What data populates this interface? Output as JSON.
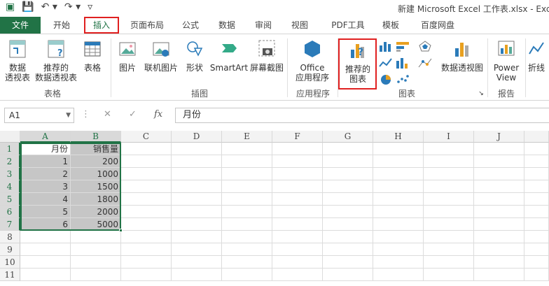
{
  "window_title": "新建 Microsoft Excel 工作表.xlsx - Exc",
  "tabs": [
    "文件",
    "开始",
    "插入",
    "页面布局",
    "公式",
    "数据",
    "审阅",
    "视图",
    "PDF工具",
    "模板",
    "百度网盘"
  ],
  "ribbon": {
    "pivot": "数据",
    "pivot2": "透视表",
    "rec_pivot": "推荐的",
    "rec_pivot2": "数据透视表",
    "table": "表格",
    "group_tables": "表格",
    "picture": "图片",
    "online_picture": "联机图片",
    "shapes": "形状",
    "smartart": "SmartArt",
    "screenshot": "屏幕截图",
    "group_illustrations": "插图",
    "office": "Office",
    "office2": "应用程序",
    "group_apps": "应用程序",
    "rec_chart": "推荐的",
    "rec_chart2": "图表",
    "group_charts": "图表",
    "pivot_chart": "数据透视图",
    "power": "Power",
    "power2": "View",
    "group_reports": "报告",
    "sparkline": "折线"
  },
  "formula_bar": {
    "name_box": "A1",
    "fx": "fx",
    "value": "月份"
  },
  "columns": [
    "A",
    "B",
    "C",
    "D",
    "E",
    "F",
    "G",
    "H",
    "I",
    "J"
  ],
  "rows": [
    "1",
    "2",
    "3",
    "4",
    "5",
    "6",
    "7",
    "8",
    "9",
    "10",
    "11"
  ],
  "sheet": {
    "headers": [
      "月份",
      "销售量"
    ],
    "data": [
      [
        "1",
        "200"
      ],
      [
        "2",
        "1000"
      ],
      [
        "3",
        "1500"
      ],
      [
        "4",
        "1800"
      ],
      [
        "5",
        "2000"
      ],
      [
        "6",
        "5000"
      ]
    ]
  }
}
